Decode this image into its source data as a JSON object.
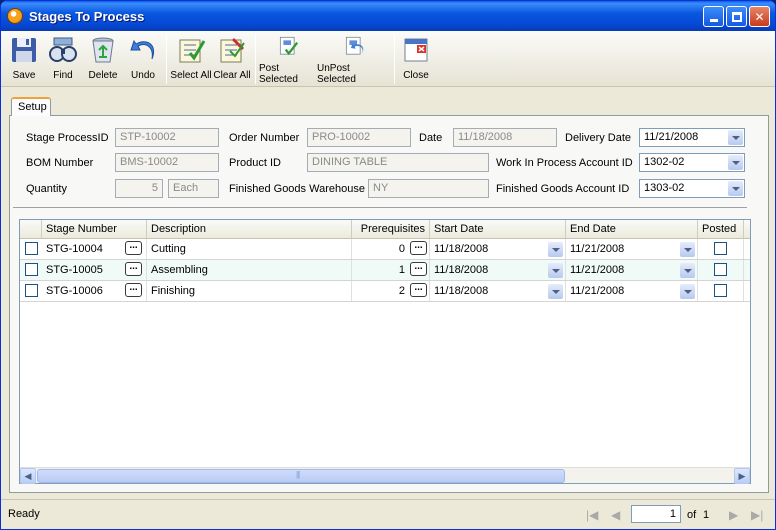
{
  "window": {
    "title": "Stages To Process"
  },
  "toolbar": {
    "save": "Save",
    "find": "Find",
    "delete": "Delete",
    "undo": "Undo",
    "select_all": "Select All",
    "clear_all": "Clear All",
    "post_selected": "Post Selected",
    "unpost_selected": "UnPost Selected",
    "close": "Close"
  },
  "tabs": {
    "setup": "Setup"
  },
  "form": {
    "stage_process_id_label": "Stage ProcessID",
    "stage_process_id": "STP-10002",
    "order_number_label": "Order Number",
    "order_number": "PRO-10002",
    "date_label": "Date",
    "date": "11/18/2008",
    "delivery_date_label": "Delivery Date",
    "delivery_date": "11/21/2008",
    "bom_number_label": "BOM Number",
    "bom_number": "BMS-10002",
    "product_id_label": "Product ID",
    "product_id": "DINING TABLE",
    "wip_account_label": "Work In Process Account ID",
    "wip_account": "1302-02",
    "quantity_label": "Quantity",
    "quantity": "5",
    "uom": "Each",
    "fg_warehouse_label": "Finished Goods Warehouse",
    "fg_warehouse": "NY",
    "fg_account_label": "Finished Goods Account ID",
    "fg_account": "1303-02"
  },
  "grid": {
    "headers": {
      "stage_number": "Stage Number",
      "description": "Description",
      "prerequisites": "Prerequisites",
      "start_date": "Start Date",
      "end_date": "End Date",
      "posted": "Posted"
    },
    "rows": [
      {
        "stage": "STG-10004",
        "description": "Cutting",
        "prereq": "0",
        "start": "11/18/2008",
        "end": "11/21/2008"
      },
      {
        "stage": "STG-10005",
        "description": "Assembling",
        "prereq": "1",
        "start": "11/18/2008",
        "end": "11/21/2008"
      },
      {
        "stage": "STG-10006",
        "description": "Finishing",
        "prereq": "2",
        "start": "11/18/2008",
        "end": "11/21/2008"
      }
    ]
  },
  "status": {
    "text": "Ready",
    "page": "1",
    "of_label": "of",
    "total_pages": "1"
  }
}
